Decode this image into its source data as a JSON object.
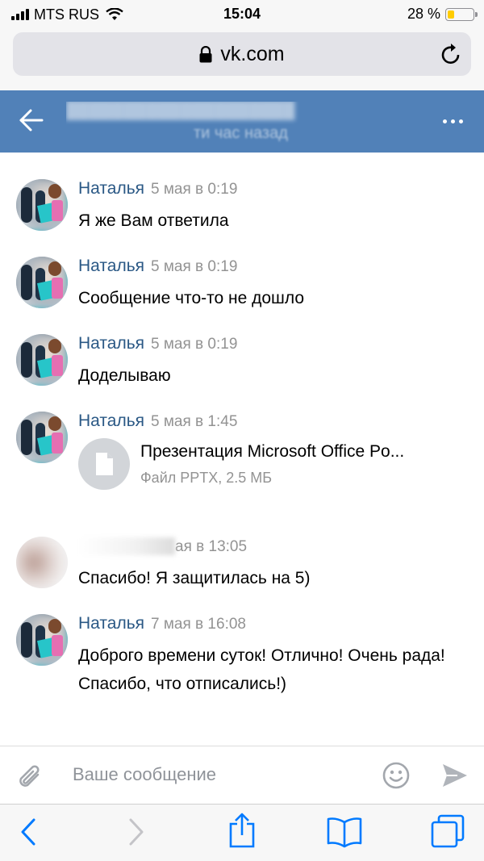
{
  "status_bar": {
    "carrier": "MTS RUS",
    "time": "15:04",
    "battery_percent": "28 %",
    "battery_level": 0.28,
    "signal_icon": "signal-bars-icon",
    "wifi_icon": "wifi-icon"
  },
  "browser": {
    "url": "vk.com",
    "lock_icon": "lock-icon",
    "reload_icon": "reload-icon"
  },
  "chat_header": {
    "status_text": "ти час назад",
    "back_icon": "back-arrow-icon",
    "more_icon": "more-dots-icon",
    "accent_color": "#5181b8"
  },
  "messages": [
    {
      "author": "Наталья",
      "time": "5 мая в 0:19",
      "text": "Я же Вам ответила"
    },
    {
      "author": "Наталья",
      "time": "5 мая в 0:19",
      "text": "Сообщение что-то не дошло"
    },
    {
      "author": "Наталья",
      "time": "5 мая в 0:19",
      "text": "Доделываю"
    },
    {
      "author": "Наталья",
      "time": "5 мая в 1:45",
      "attachment": {
        "title": "Презентация Microsoft Office Po...",
        "subtitle": "Файл PPTX, 2.5 МБ"
      }
    },
    {
      "author_visible": "",
      "time": "ая в 13:05",
      "text": "Спасибо! Я защитилась на 5)"
    },
    {
      "author": "Наталья",
      "time": "7 мая в 16:08",
      "text": "Доброго времени суток! Отлично! Очень рада! Спасибо, что отписались!)"
    }
  ],
  "composer": {
    "placeholder": "Ваше сообщение",
    "attach_icon": "paperclip-icon",
    "emoji_icon": "smiley-icon",
    "send_icon": "send-icon"
  },
  "safari_toolbar": {
    "items": [
      "back-icon",
      "forward-icon",
      "share-icon",
      "bookmarks-icon",
      "tabs-icon"
    ],
    "accent_color": "#007aff"
  },
  "colors": {
    "name_link": "#2a5885",
    "meta_gray": "#939393"
  }
}
